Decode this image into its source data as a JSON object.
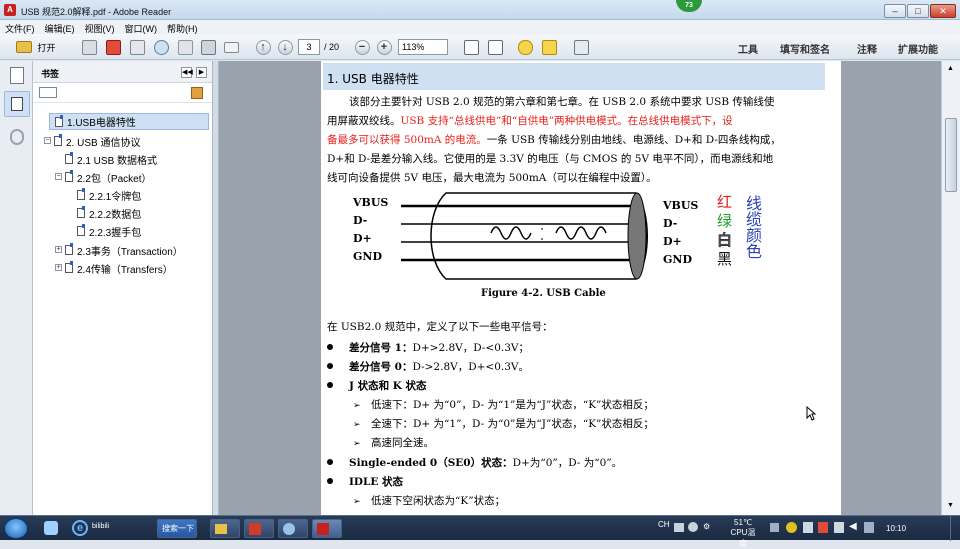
{
  "window": {
    "title": "USB 规范2.0解释.pdf - Adobe Reader",
    "badge": "73"
  },
  "winbuttons": {
    "minimize": "–",
    "maximize": "□",
    "close": "✕"
  },
  "menu": [
    "文件(F)",
    "编辑(E)",
    "视图(V)",
    "窗口(W)",
    "帮助(H)"
  ],
  "toolbar": {
    "open": "打开",
    "page_current": "3",
    "page_total": "/ 20",
    "zoom": "113%",
    "tools": "工具",
    "sign": "填写和签名",
    "comment": "注释",
    "extend": "扩展功能"
  },
  "sidebar": {
    "title": "书签",
    "items": [
      {
        "label": "1.USB电器特性",
        "level": 0,
        "selected": true
      },
      {
        "label": "2. USB 通信协议",
        "level": 0,
        "toggle": "−"
      },
      {
        "label": "2.1 USB 数据格式",
        "level": 1
      },
      {
        "label": "2.2包（Packet）",
        "level": 1,
        "toggle": "−"
      },
      {
        "label": "2.2.1令牌包",
        "level": 2
      },
      {
        "label": "2.2.2数据包",
        "level": 2
      },
      {
        "label": "2.2.3握手包",
        "level": 2
      },
      {
        "label": "2.3事务（Transaction）",
        "level": 0,
        "toggle": "+"
      },
      {
        "label": "2.4传输（Transfers）",
        "level": 0,
        "toggle": "+"
      }
    ]
  },
  "doc": {
    "heading": "1. USB 电器特性",
    "p1a": "该部分主要针对 USB 2.0 规范的第六章和第七章。在 USB 2.0 系统中要求 USB 传输线使",
    "p1b_black": "用屏蔽双绞线。",
    "p1b_red": "USB 支持“总线供电”和“自供电”两种供电模式。在总线供电模式下，设",
    "p1c_red": "备最多可以获得 500mA 的电流。",
    "p1c_black": "一条 USB 传输线分别由地线、电源线、D+和 D-四条线构成，",
    "p1d": "D+和 D-是差分输入线。它使用的是 3.3V 的电压（与 CMOS 的 5V 电平不同），而电源线和地",
    "p1e": "线可向设备提供 5V 电压，最大电流为 500mA（可以在编程中设置）。",
    "figure": {
      "left_labels": [
        "VBUS",
        "D-",
        "D+",
        "GND"
      ],
      "right_labels": [
        "VBUS",
        "D-",
        "D+",
        "GND"
      ],
      "color_words": [
        "红",
        "绿",
        "白",
        "黑"
      ],
      "vertical_note": "线缆颜色",
      "caption": "Figure 4-2.  USB Cable"
    },
    "p2": "在 USB2.0 规范中，定义了以下一些电平信号：",
    "bullets": [
      {
        "bold": "差分信号 1：",
        "text": "D+>2.8V，D-<0.3V；"
      },
      {
        "bold": "差分信号 0：",
        "text": "D->2.8V，D+<0.3V。"
      },
      {
        "bold": "J 状态和 K 状态",
        "text": ""
      }
    ],
    "subs1": [
      "低速下：D+ 为“0”，D- 为“1”是为“J”状态，“K”状态相反；",
      "全速下：D+ 为“1”，D- 为“0”是为“J”状态，“K”状态相反；",
      "高速同全速。"
    ],
    "bullet4": {
      "bold": "Single-ended 0（SE0）状态：",
      "text": "D+为“0”，D- 为“0”。"
    },
    "bullet5": {
      "bold": "IDLE 状态",
      "text": ""
    },
    "subs2": [
      "低速下空闲状态为“K”状态；"
    ]
  },
  "taskbar": {
    "ie_label": "bilibili",
    "search": "搜索一下",
    "tray_lang": "CH",
    "temp": "51℃",
    "temp_label": "CPU温度",
    "time": "10:10"
  }
}
